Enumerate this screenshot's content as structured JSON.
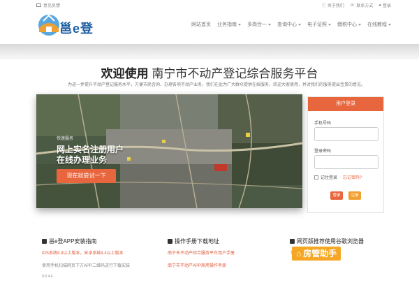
{
  "topbar": {
    "feedback": "意见反馈",
    "about": "关于我们",
    "contact": "联系方式",
    "login": "登录"
  },
  "header": {
    "logo_text": "邕e登",
    "nav": [
      "网站首页",
      "业务指南",
      "多岗合一",
      "查询中心",
      "电子证照",
      "缴税中心",
      "在线教程"
    ]
  },
  "welcome": {
    "title_bold": "欢迎使用",
    "title_rest": "南宁市不动产登记综合服务平台",
    "subtitle": "为进一步提升不动产登记服务水平，方便市民咨询、办理各项不动产业务，我们在此为广大群众提供在线服务，欢迎大家使用，并对我们的服务提出宝贵的意见。"
  },
  "hero": {
    "small": "快速服务",
    "line1": "网上实名注册用户",
    "line2": "在线办理业务",
    "cta": "现在就尝试一下"
  },
  "login": {
    "header": "用户登录",
    "phone_label": "手机号码",
    "password_label": "登录密码",
    "remember": "记住登录",
    "forgot": "忘记密码?",
    "login_btn": "登录",
    "register_btn": "注册"
  },
  "columns": [
    {
      "title": "邕e登APP安装指南",
      "lines": [
        "iOS系统9.3以上版本，安卓系统4.4以上版本",
        "使用手机扫描网页下方APP二维码进行下载安装",
        "9.3  4.4"
      ]
    },
    {
      "title": "操作手册下载地址",
      "lines": [
        "南宁市不动产综合服务平台用户手册",
        "南宁市不动产APP商用操作手册"
      ]
    },
    {
      "title": "网页版推荐使用谷歌浏览器",
      "lines": [
        "下载谷歌浏览器"
      ]
    }
  ],
  "watermark": "房管助手",
  "colors": {
    "accent": "#e8663d",
    "brand": "#1f5fa5"
  }
}
